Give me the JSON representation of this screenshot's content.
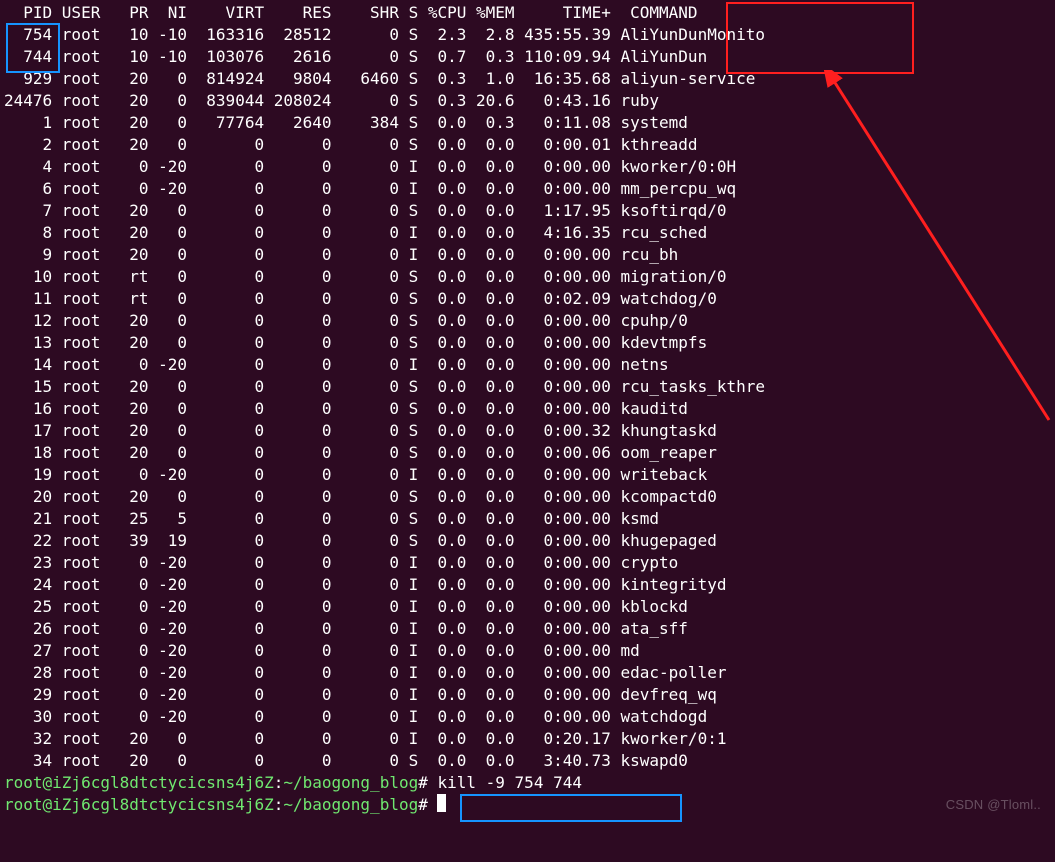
{
  "header": {
    "PID": "PID",
    "USER": "USER",
    "PR": "PR",
    "NI": "NI",
    "VIRT": "VIRT",
    "RES": "RES",
    "SHR": "SHR",
    "S": "S",
    "CPU": "%CPU",
    "MEM": "%MEM",
    "TIME": "TIME+",
    "COMMAND": "COMMAND"
  },
  "rows": [
    {
      "pid": "754",
      "user": "root",
      "pr": "10",
      "ni": "-10",
      "virt": "163316",
      "res": "28512",
      "shr": "0",
      "s": "S",
      "cpu": "2.3",
      "mem": "2.8",
      "time": "435:55.39",
      "cmd": "AliYunDunMonito"
    },
    {
      "pid": "744",
      "user": "root",
      "pr": "10",
      "ni": "-10",
      "virt": "103076",
      "res": "2616",
      "shr": "0",
      "s": "S",
      "cpu": "0.7",
      "mem": "0.3",
      "time": "110:09.94",
      "cmd": "AliYunDun"
    },
    {
      "pid": "929",
      "user": "root",
      "pr": "20",
      "ni": "0",
      "virt": "814924",
      "res": "9804",
      "shr": "6460",
      "s": "S",
      "cpu": "0.3",
      "mem": "1.0",
      "time": "16:35.68",
      "cmd": "aliyun-service"
    },
    {
      "pid": "24476",
      "user": "root",
      "pr": "20",
      "ni": "0",
      "virt": "839044",
      "res": "208024",
      "shr": "0",
      "s": "S",
      "cpu": "0.3",
      "mem": "20.6",
      "time": "0:43.16",
      "cmd": "ruby"
    },
    {
      "pid": "1",
      "user": "root",
      "pr": "20",
      "ni": "0",
      "virt": "77764",
      "res": "2640",
      "shr": "384",
      "s": "S",
      "cpu": "0.0",
      "mem": "0.3",
      "time": "0:11.08",
      "cmd": "systemd"
    },
    {
      "pid": "2",
      "user": "root",
      "pr": "20",
      "ni": "0",
      "virt": "0",
      "res": "0",
      "shr": "0",
      "s": "S",
      "cpu": "0.0",
      "mem": "0.0",
      "time": "0:00.01",
      "cmd": "kthreadd"
    },
    {
      "pid": "4",
      "user": "root",
      "pr": "0",
      "ni": "-20",
      "virt": "0",
      "res": "0",
      "shr": "0",
      "s": "I",
      "cpu": "0.0",
      "mem": "0.0",
      "time": "0:00.00",
      "cmd": "kworker/0:0H"
    },
    {
      "pid": "6",
      "user": "root",
      "pr": "0",
      "ni": "-20",
      "virt": "0",
      "res": "0",
      "shr": "0",
      "s": "I",
      "cpu": "0.0",
      "mem": "0.0",
      "time": "0:00.00",
      "cmd": "mm_percpu_wq"
    },
    {
      "pid": "7",
      "user": "root",
      "pr": "20",
      "ni": "0",
      "virt": "0",
      "res": "0",
      "shr": "0",
      "s": "S",
      "cpu": "0.0",
      "mem": "0.0",
      "time": "1:17.95",
      "cmd": "ksoftirqd/0"
    },
    {
      "pid": "8",
      "user": "root",
      "pr": "20",
      "ni": "0",
      "virt": "0",
      "res": "0",
      "shr": "0",
      "s": "I",
      "cpu": "0.0",
      "mem": "0.0",
      "time": "4:16.35",
      "cmd": "rcu_sched"
    },
    {
      "pid": "9",
      "user": "root",
      "pr": "20",
      "ni": "0",
      "virt": "0",
      "res": "0",
      "shr": "0",
      "s": "I",
      "cpu": "0.0",
      "mem": "0.0",
      "time": "0:00.00",
      "cmd": "rcu_bh"
    },
    {
      "pid": "10",
      "user": "root",
      "pr": "rt",
      "ni": "0",
      "virt": "0",
      "res": "0",
      "shr": "0",
      "s": "S",
      "cpu": "0.0",
      "mem": "0.0",
      "time": "0:00.00",
      "cmd": "migration/0"
    },
    {
      "pid": "11",
      "user": "root",
      "pr": "rt",
      "ni": "0",
      "virt": "0",
      "res": "0",
      "shr": "0",
      "s": "S",
      "cpu": "0.0",
      "mem": "0.0",
      "time": "0:02.09",
      "cmd": "watchdog/0"
    },
    {
      "pid": "12",
      "user": "root",
      "pr": "20",
      "ni": "0",
      "virt": "0",
      "res": "0",
      "shr": "0",
      "s": "S",
      "cpu": "0.0",
      "mem": "0.0",
      "time": "0:00.00",
      "cmd": "cpuhp/0"
    },
    {
      "pid": "13",
      "user": "root",
      "pr": "20",
      "ni": "0",
      "virt": "0",
      "res": "0",
      "shr": "0",
      "s": "S",
      "cpu": "0.0",
      "mem": "0.0",
      "time": "0:00.00",
      "cmd": "kdevtmpfs"
    },
    {
      "pid": "14",
      "user": "root",
      "pr": "0",
      "ni": "-20",
      "virt": "0",
      "res": "0",
      "shr": "0",
      "s": "I",
      "cpu": "0.0",
      "mem": "0.0",
      "time": "0:00.00",
      "cmd": "netns"
    },
    {
      "pid": "15",
      "user": "root",
      "pr": "20",
      "ni": "0",
      "virt": "0",
      "res": "0",
      "shr": "0",
      "s": "S",
      "cpu": "0.0",
      "mem": "0.0",
      "time": "0:00.00",
      "cmd": "rcu_tasks_kthre"
    },
    {
      "pid": "16",
      "user": "root",
      "pr": "20",
      "ni": "0",
      "virt": "0",
      "res": "0",
      "shr": "0",
      "s": "S",
      "cpu": "0.0",
      "mem": "0.0",
      "time": "0:00.00",
      "cmd": "kauditd"
    },
    {
      "pid": "17",
      "user": "root",
      "pr": "20",
      "ni": "0",
      "virt": "0",
      "res": "0",
      "shr": "0",
      "s": "S",
      "cpu": "0.0",
      "mem": "0.0",
      "time": "0:00.32",
      "cmd": "khungtaskd"
    },
    {
      "pid": "18",
      "user": "root",
      "pr": "20",
      "ni": "0",
      "virt": "0",
      "res": "0",
      "shr": "0",
      "s": "S",
      "cpu": "0.0",
      "mem": "0.0",
      "time": "0:00.06",
      "cmd": "oom_reaper"
    },
    {
      "pid": "19",
      "user": "root",
      "pr": "0",
      "ni": "-20",
      "virt": "0",
      "res": "0",
      "shr": "0",
      "s": "I",
      "cpu": "0.0",
      "mem": "0.0",
      "time": "0:00.00",
      "cmd": "writeback"
    },
    {
      "pid": "20",
      "user": "root",
      "pr": "20",
      "ni": "0",
      "virt": "0",
      "res": "0",
      "shr": "0",
      "s": "S",
      "cpu": "0.0",
      "mem": "0.0",
      "time": "0:00.00",
      "cmd": "kcompactd0"
    },
    {
      "pid": "21",
      "user": "root",
      "pr": "25",
      "ni": "5",
      "virt": "0",
      "res": "0",
      "shr": "0",
      "s": "S",
      "cpu": "0.0",
      "mem": "0.0",
      "time": "0:00.00",
      "cmd": "ksmd"
    },
    {
      "pid": "22",
      "user": "root",
      "pr": "39",
      "ni": "19",
      "virt": "0",
      "res": "0",
      "shr": "0",
      "s": "S",
      "cpu": "0.0",
      "mem": "0.0",
      "time": "0:00.00",
      "cmd": "khugepaged"
    },
    {
      "pid": "23",
      "user": "root",
      "pr": "0",
      "ni": "-20",
      "virt": "0",
      "res": "0",
      "shr": "0",
      "s": "I",
      "cpu": "0.0",
      "mem": "0.0",
      "time": "0:00.00",
      "cmd": "crypto"
    },
    {
      "pid": "24",
      "user": "root",
      "pr": "0",
      "ni": "-20",
      "virt": "0",
      "res": "0",
      "shr": "0",
      "s": "I",
      "cpu": "0.0",
      "mem": "0.0",
      "time": "0:00.00",
      "cmd": "kintegrityd"
    },
    {
      "pid": "25",
      "user": "root",
      "pr": "0",
      "ni": "-20",
      "virt": "0",
      "res": "0",
      "shr": "0",
      "s": "I",
      "cpu": "0.0",
      "mem": "0.0",
      "time": "0:00.00",
      "cmd": "kblockd"
    },
    {
      "pid": "26",
      "user": "root",
      "pr": "0",
      "ni": "-20",
      "virt": "0",
      "res": "0",
      "shr": "0",
      "s": "I",
      "cpu": "0.0",
      "mem": "0.0",
      "time": "0:00.00",
      "cmd": "ata_sff"
    },
    {
      "pid": "27",
      "user": "root",
      "pr": "0",
      "ni": "-20",
      "virt": "0",
      "res": "0",
      "shr": "0",
      "s": "I",
      "cpu": "0.0",
      "mem": "0.0",
      "time": "0:00.00",
      "cmd": "md"
    },
    {
      "pid": "28",
      "user": "root",
      "pr": "0",
      "ni": "-20",
      "virt": "0",
      "res": "0",
      "shr": "0",
      "s": "I",
      "cpu": "0.0",
      "mem": "0.0",
      "time": "0:00.00",
      "cmd": "edac-poller"
    },
    {
      "pid": "29",
      "user": "root",
      "pr": "0",
      "ni": "-20",
      "virt": "0",
      "res": "0",
      "shr": "0",
      "s": "I",
      "cpu": "0.0",
      "mem": "0.0",
      "time": "0:00.00",
      "cmd": "devfreq_wq"
    },
    {
      "pid": "30",
      "user": "root",
      "pr": "0",
      "ni": "-20",
      "virt": "0",
      "res": "0",
      "shr": "0",
      "s": "I",
      "cpu": "0.0",
      "mem": "0.0",
      "time": "0:00.00",
      "cmd": "watchdogd"
    },
    {
      "pid": "32",
      "user": "root",
      "pr": "20",
      "ni": "0",
      "virt": "0",
      "res": "0",
      "shr": "0",
      "s": "I",
      "cpu": "0.0",
      "mem": "0.0",
      "time": "0:20.17",
      "cmd": "kworker/0:1"
    },
    {
      "pid": "34",
      "user": "root",
      "pr": "20",
      "ni": "0",
      "virt": "0",
      "res": "0",
      "shr": "0",
      "s": "S",
      "cpu": "0.0",
      "mem": "0.0",
      "time": "3:40.73",
      "cmd": "kswapd0"
    }
  ],
  "prompt1": {
    "prefix": "root@iZj6cgl8dtctycicsns4j6Z",
    "sep": ":",
    "path": "~/baogong_blog",
    "suffix": "#",
    "command": "kill -9 754 744"
  },
  "prompt2": {
    "prefix": "root@iZj6cgl8dtctycicsns4j6Z",
    "sep": ":",
    "path": "~/baogong_blog",
    "suffix": "#",
    "command": ""
  },
  "watermark": "CSDN @Tloml.."
}
